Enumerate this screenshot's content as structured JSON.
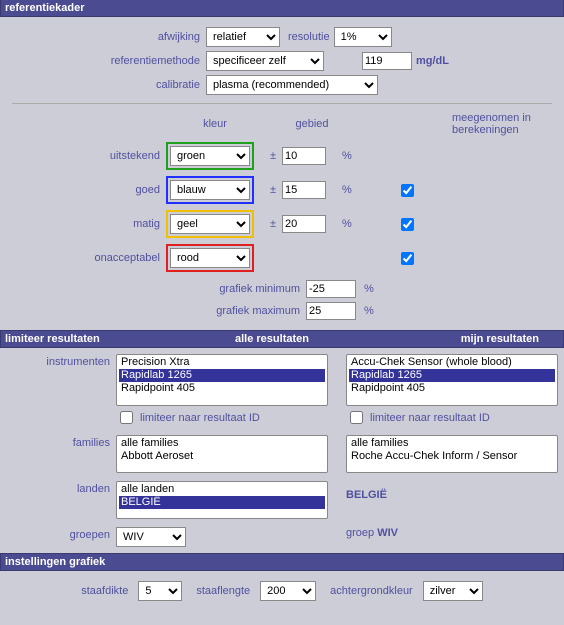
{
  "headers": {
    "referentiekader": "referentiekader",
    "limiteer": "limiteer resultaten",
    "alle": "alle resultaten",
    "mijn": "mijn resultaten",
    "grafiek": "instellingen grafiek"
  },
  "labels": {
    "afwijking": "afwijking",
    "resolutie": "resolutie",
    "referentiemethode": "referentiemethode",
    "calibratie": "calibratie",
    "kleur": "kleur",
    "gebied": "gebied",
    "meegenomen": "meegenomen in berekeningen",
    "uitstekend": "uitstekend",
    "goed": "goed",
    "matig": "matig",
    "onacceptabel": "onacceptabel",
    "grafiek_min": "grafiek minimum",
    "grafiek_max": "grafiek maximum",
    "instrumenten": "instrumenten",
    "limiteer_id": "limiteer naar resultaat ID",
    "families": "families",
    "landen": "landen",
    "groepen": "groepen",
    "groep": "groep",
    "staafdikte": "staafdikte",
    "staaflengte": "staaflengte",
    "achtergrondkleur": "achtergrondkleur",
    "pm": "±",
    "pct": "%",
    "mgdl": "mg/dL"
  },
  "values": {
    "afwijking": "relatief",
    "resolutie": "1%",
    "referentiemethode": "specificeer zelf",
    "ref_value": "119",
    "calibratie": "plasma (recommended)",
    "colour_uitstekend": "groen",
    "colour_goed": "blauw",
    "colour_matig": "geel",
    "colour_onacceptabel": "rood",
    "gebied_uitstekend": "10",
    "gebied_goed": "15",
    "gebied_matig": "20",
    "chk_goed": true,
    "chk_matig": true,
    "chk_onacceptabel": true,
    "grafiek_min": "-25",
    "grafiek_max": "25",
    "groep_sel": "WIV",
    "groep_mine": "WIV",
    "land_mine": "BELGIË",
    "staafdikte": "5",
    "staaflengte": "200",
    "achtergrondkleur": "zilver"
  },
  "lists": {
    "instrumenten_all": [
      "Precision Xtra",
      "Rapidlab 1265",
      "Rapidpoint 405"
    ],
    "instrumenten_all_selected": "Rapidlab 1265",
    "instrumenten_mine": [
      "Accu-Chek Sensor (whole blood)",
      "Rapidlab 1265",
      "Rapidpoint 405"
    ],
    "instrumenten_mine_selected": "Rapidlab 1265",
    "families_all": [
      "alle families",
      "Abbott Aeroset"
    ],
    "families_mine": [
      "alle families",
      "Roche Accu-Chek Inform / Sensor"
    ],
    "landen_all": [
      "alle landen",
      "BELGIË"
    ],
    "landen_all_selected": "BELGIË"
  }
}
